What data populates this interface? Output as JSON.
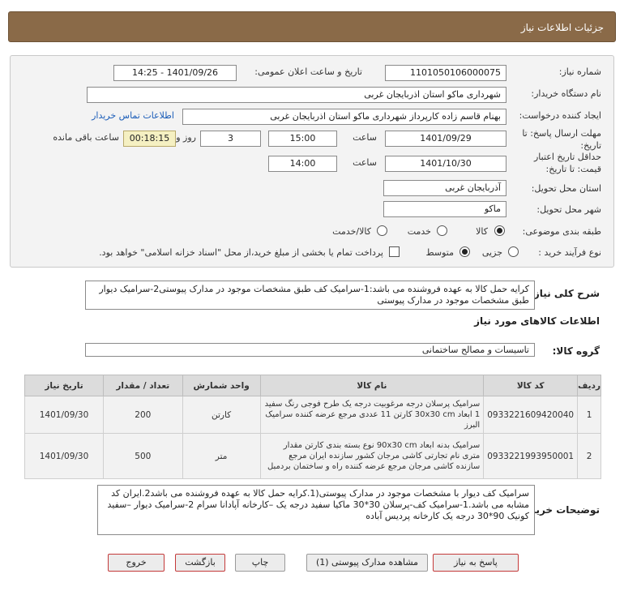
{
  "header": {
    "title": "جزئیات اطلاعات نیاز"
  },
  "form": {
    "need_number": {
      "label": "شماره نیاز:",
      "value": "1101050106000075"
    },
    "announce_datetime": {
      "label": "تاریخ و ساعت اعلان عمومی:",
      "value": "1401/09/26 - 14:25"
    },
    "buyer_org": {
      "label": "نام دستگاه خریدار:",
      "value": "شهرداری ماکو استان اذربایجان غربی"
    },
    "requester": {
      "label": "ایجاد کننده درخواست:",
      "value": "بهنام قاسم زاده کارپرداز شهرداری ماکو استان اذربایجان غربی",
      "contact_link": "اطلاعات تماس خریدار"
    },
    "deadline": {
      "label": "مهلت ارسال پاسخ: تا تاریخ:",
      "date": "1401/09/29",
      "time_label": "ساعت",
      "time": "15:00",
      "days": "3",
      "days_label": "روز و",
      "remaining": "00:18:15",
      "remaining_label": "ساعت باقی مانده"
    },
    "validity": {
      "label": "حداقل تاریخ اعتبار قیمت: تا تاریخ:",
      "date": "1401/10/30",
      "time_label": "ساعت",
      "time": "14:00"
    },
    "province": {
      "label": "استان محل تحویل:",
      "value": "آذربایجان غربی"
    },
    "city": {
      "label": "شهر محل تحویل:",
      "value": "ماکو"
    },
    "category": {
      "label": "طبقه بندی موضوعی:",
      "options": [
        "کالا",
        "خدمت",
        "کالا/خدمت"
      ],
      "selected": "کالا"
    },
    "purchase_type": {
      "label": "نوع فرآیند خرید :",
      "options": [
        "جزیی",
        "متوسط"
      ],
      "selected": "متوسط",
      "payment_note": "پرداخت تمام یا بخشی از مبلغ خرید،از محل \"اسناد خزانه اسلامی\" خواهد بود."
    }
  },
  "description": {
    "label": "شرح کلی نیاز:",
    "text": "کرایه حمل کالا به عهده فروشنده می باشد:1-سرامیک کف طبق مشخصات موجود در مدارک پیوستی2-سرامیک دیوار طبق مشخصات موجود در مدارک پیوستی"
  },
  "goods_section": {
    "title": "اطلاعات کالاهای مورد نیاز",
    "group_label": "گروه کالا:",
    "group_value": "تاسیسات و مصالح ساختمانی"
  },
  "table": {
    "headers": [
      "ردیف",
      "کد کالا",
      "نام کالا",
      "واحد شمارش",
      "تعداد / مقدار",
      "تاریخ نیاز"
    ],
    "rows": [
      {
        "row": "1",
        "code": "0933221609420040",
        "name": "سرامیک پرسلان درجه مرغوبیت درجه یک طرح فوجی رنگ سفید 1 ابعاد 30x30 cm کارتن 11 عددی مرجع عرضه کننده سرامیک البرز",
        "unit": "کارتن",
        "qty": "200",
        "date": "1401/09/30"
      },
      {
        "row": "2",
        "code": "0933221993950001",
        "name": "سرامیک بدنه ابعاد 90x30 cm نوع بسته بندی کارتن مقدار متری نام تجارتی کاشی مرجان کشور سازنده ایران مرجع سازنده کاشی مرجان مرجع عرضه کننده راه و ساختمان بردمبل",
        "unit": "متر",
        "qty": "500",
        "date": "1401/09/30"
      }
    ]
  },
  "buyer_notes": {
    "label": "توضیحات خریدار:",
    "text": "سرامیک کف دیوار با مشخصات موجود در مدارک پیوستی(1.کرایه حمل کالا به عهده فروشنده می باشد2.ایران کد مشابه می باشد.1-سرامیک کف-پرسلان 30*30 ماکیا سفید درجه یک –کارخانه آپادانا سرام 2-سرامیک دیوار –سفید کونیک 90*30 درجه یک کارخانه پردیس آباده"
  },
  "buttons": {
    "reply": "پاسخ به نیاز",
    "view_docs": "مشاهده مدارک پیوستی (1)",
    "print": "چاپ",
    "back": "بازگشت",
    "exit": "خروج"
  },
  "colors": {
    "titlebar": "#8a6a48",
    "link": "#1a5cb8",
    "timer_bg": "#f5f0c2"
  }
}
